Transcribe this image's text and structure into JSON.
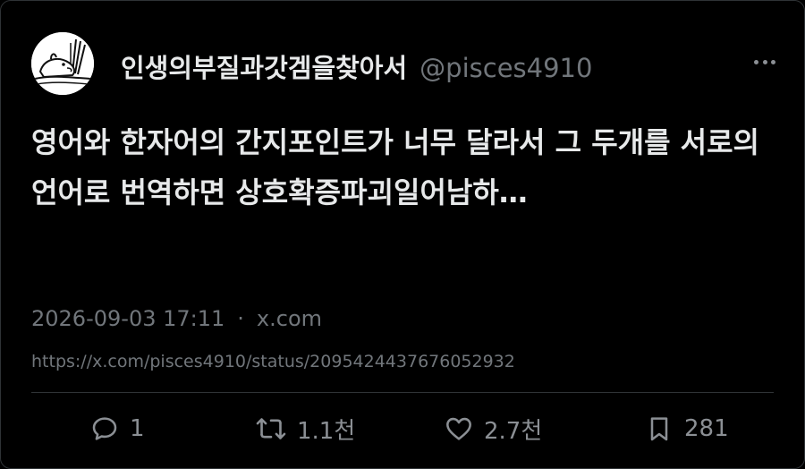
{
  "user": {
    "display_name": "인생의부질과갓겜을찾아서",
    "handle": "@pisces4910"
  },
  "tweet": {
    "text": "영어와 한자어의 간지포인트가 너무 달라서 그 두개를 서로의 언어로 번역하면 상호확증파괴일어남하…",
    "timestamp": "2026-09-03 17:11",
    "separator": "·",
    "source": "x.com",
    "url": "https://x.com/pisces4910/status/2095424437676052932"
  },
  "actions": {
    "replies": "1",
    "retweets": "1.1천",
    "likes": "2.7천",
    "bookmarks": "281"
  },
  "icons": {
    "more": "more-horizontal-icon",
    "reply": "reply-icon",
    "retweet": "retweet-icon",
    "like": "heart-icon",
    "bookmark": "bookmark-icon"
  },
  "colors": {
    "background": "#000000",
    "text_primary": "#e7e9ea",
    "text_secondary": "#71767b",
    "divider": "#2f3336"
  }
}
